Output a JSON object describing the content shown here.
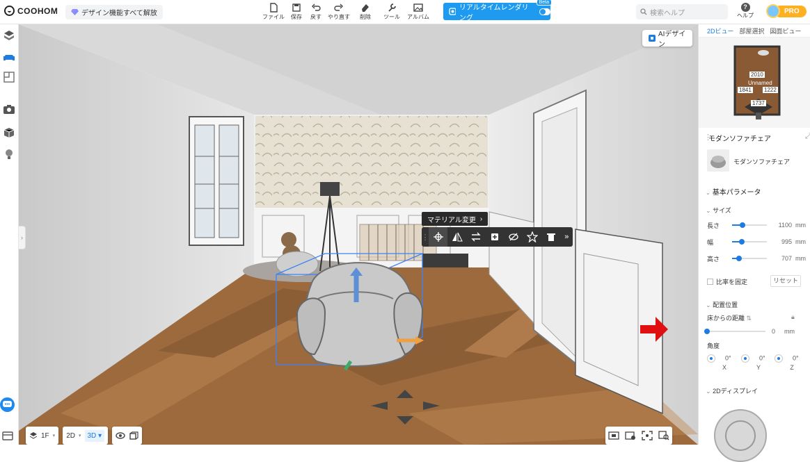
{
  "app": {
    "logo_text": "COOHOM",
    "promo_text": "デザイン機能すべて解放"
  },
  "toolbar": {
    "items": [
      {
        "label": "ファイル",
        "icon": "file-icon"
      },
      {
        "label": "保存",
        "icon": "save-icon"
      },
      {
        "label": "戻す",
        "icon": "undo-icon"
      },
      {
        "label": "やり直す",
        "icon": "redo-icon"
      },
      {
        "label": "削除",
        "icon": "eraser-icon"
      },
      {
        "label": "ツール",
        "icon": "wrench-icon"
      },
      {
        "label": "アルバム",
        "icon": "album-icon"
      }
    ],
    "render_label": "リアルタイムレンダリング",
    "render_badge": "Beta",
    "search_placeholder": "検索ヘルプ",
    "help_label": "ヘルプ",
    "plan_label": "PRO"
  },
  "viewport": {
    "ai_button": "AIデザイン",
    "material_tip": "マテリアル変更",
    "context_tools": [
      "move-icon",
      "mirror-icon",
      "replace-icon",
      "copy-icon",
      "hide-icon",
      "favorite-icon",
      "delete-icon",
      "more-icon"
    ]
  },
  "bottom": {
    "floor": "1F",
    "view2d": "2D",
    "view3d": "3D"
  },
  "right_panel": {
    "tabs": [
      "2Dビュー",
      "部屋選択",
      "図面ビュー"
    ],
    "minimap": {
      "top": "2010",
      "name": "Unnamed",
      "left": "1841",
      "right": "1222",
      "bottom": "1737"
    },
    "title": "モダンソファチェア",
    "item_name": "モダンソファチェア",
    "basic_params": "基本パラメータ",
    "size_section": "サイズ",
    "size": [
      {
        "label": "長さ",
        "value": "1100",
        "unit": "mm",
        "level": 0.3
      },
      {
        "label": "幅",
        "value": "995",
        "unit": "mm",
        "level": 0.27
      },
      {
        "label": "高さ",
        "value": "707",
        "unit": "mm",
        "level": 0.2
      }
    ],
    "keep_ratio": "比率を固定",
    "reset": "リセット",
    "placement": "配置位置",
    "floor_distance_label": "床からの距離",
    "floor_distance_value": "0",
    "floor_distance_unit": "mm",
    "angle_label": "角度",
    "angles": [
      {
        "axis": "X",
        "value": "0°"
      },
      {
        "axis": "Y",
        "value": "0°"
      },
      {
        "axis": "Z",
        "value": "0°"
      }
    ],
    "display_2d": "2Dディスプレイ"
  },
  "colors": {
    "accent": "#1e9bf0",
    "pro": "#ffb020",
    "arrow": "#e01010"
  }
}
